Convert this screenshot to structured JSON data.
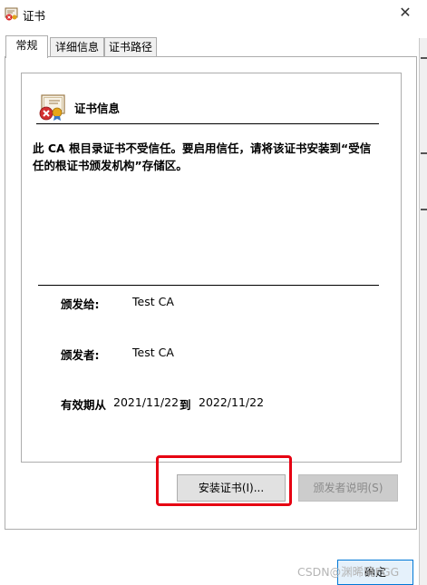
{
  "window": {
    "title": "证书"
  },
  "tabs": [
    {
      "label": "常规",
      "selected": true
    },
    {
      "label": "详细信息",
      "selected": false
    },
    {
      "label": "证书路径",
      "selected": false
    }
  ],
  "certificate": {
    "section_title": "证书信息",
    "warning_line1": "此 CA 根目录证书不受信任。要启用信任，请将该证书安装到“受信",
    "warning_line2": "任的根证书颁发机构”存储区。",
    "issued_to_label": "颁发给:",
    "issued_to_value": "Test CA",
    "issued_by_label": "颁发者:",
    "issued_by_value": "Test CA",
    "valid_label": "有效期从",
    "valid_from": "2021/11/22",
    "valid_to_label": "到",
    "valid_to": "2022/11/22"
  },
  "buttons": {
    "install": "安装证书(I)...",
    "issuer_statement": "颁发者说明(S)",
    "ok": "确定"
  },
  "watermark": "CSDN@渊晞晓FGG",
  "colors": {
    "highlight": "#e60012",
    "disabled_text": "#8a8a8a",
    "ok_border": "#0078d7"
  },
  "icons": {
    "window": "certificate-icon",
    "close": "close-icon",
    "cert_status": "certificate-error-icon"
  }
}
